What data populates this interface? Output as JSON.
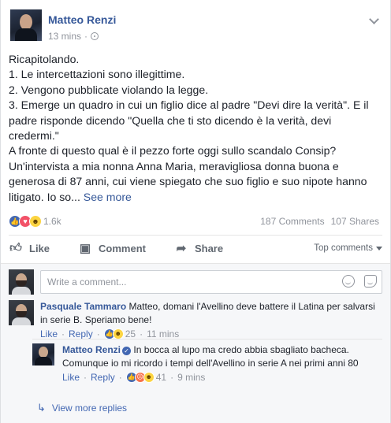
{
  "post": {
    "author": "Matteo Renzi",
    "time": "13 mins",
    "paragraphs": [
      "Ricapitolando.",
      "1. Le intercettazioni sono illegittime.",
      "2. Vengono pubblicate violando la legge.",
      "3. Emerge un quadro in cui un figlio dice al padre \"Devi dire la verità\". E il padre risponde dicendo \"Quella che ti sto dicendo è la verità, devi credermi.\"",
      "A fronte di questo qual è il pezzo forte oggi sullo scandalo Consip? Un'intervista a mia nonna Anna Maria, meravigliosa donna buona e generosa di 87 anni, cui viene spiegato che suo figlio e suo nipote hanno litigato. Io so..."
    ],
    "see_more": "See more"
  },
  "stats": {
    "reactions_count": "1.6k",
    "comments": "187 Comments",
    "shares": "107 Shares"
  },
  "actions": {
    "like": "Like",
    "comment": "Comment",
    "share": "Share",
    "top_comments": "Top comments"
  },
  "composer": {
    "placeholder": "Write a comment..."
  },
  "comments": [
    {
      "author": "Pasquale Tammaro",
      "text": "Matteo, domani l'Avellino deve battere il Latina per salvarsi in serie B. Speriamo bene!",
      "like": "Like",
      "reply": "Reply",
      "reactions": "25",
      "time": "11 mins"
    }
  ],
  "reply": {
    "author": "Matteo Renzi",
    "verified_mark": "✓",
    "text": "In bocca al lupo ma credo abbia sbagliato bacheca. Comunque io mi ricordo i tempi dell'Avellino in serie A nei primi anni 80",
    "like": "Like",
    "reply": "Reply",
    "reactions": "41",
    "time": "9 mins"
  },
  "view_more_replies": "View more replies",
  "separator": "·",
  "icons": {
    "like": "thumbs-up-icon",
    "comment": "speech-bubble-icon",
    "share": "share-arrow-icon",
    "privacy": "globe-icon"
  },
  "colors": {
    "link": "#365899",
    "like_blue": "#4267b2",
    "love_red": "#f25268",
    "haha_yellow": "#fcd441"
  }
}
